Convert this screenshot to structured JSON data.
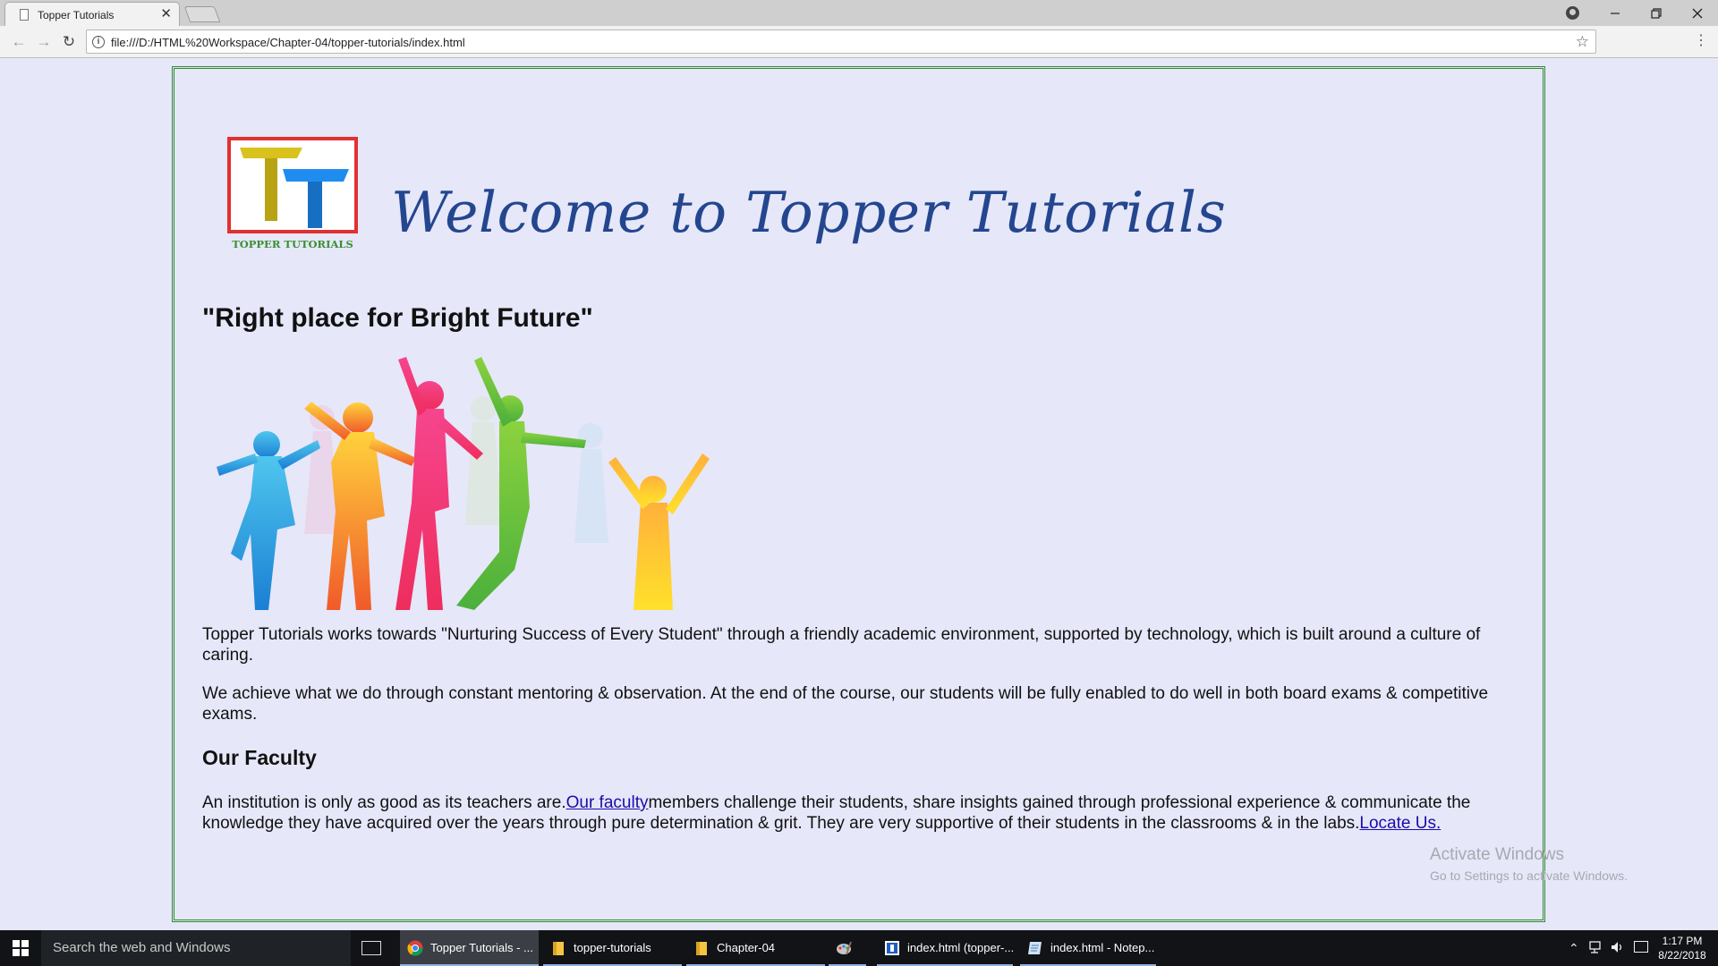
{
  "browser": {
    "tab_title": "Topper Tutorials",
    "url": "file:///D:/HTML%20Workspace/Chapter-04/topper-tutorials/index.html"
  },
  "page": {
    "logo_text": "TOPPER TUTORIALS",
    "welcome_heading": "Welcome to Topper Tutorials",
    "tagline": "\"Right place for Bright Future\"",
    "paragraph1": "Topper Tutorials works towards \"Nurturing Success of Every Student\" through a friendly academic environment, supported by technology, which is built around a culture of caring.",
    "paragraph2": "We achieve what we do through constant mentoring & observation. At the end of the course, our students will be fully enabled to do well in both board exams & competitive exams.",
    "faculty_heading": "Our Faculty",
    "faculty_para": {
      "before_link": "An institution is only as good as its teachers are.",
      "faculty_link": "Our faculty",
      "middle": "members challenge their students, share insights gained through professional experience & communicate the knowledge they have acquired over the years through pure determination & grit. They are very supportive of their students in the classrooms & in the labs.",
      "locate_link": "Locate Us."
    },
    "colors": {
      "background": "#e6e7f9",
      "heading_blue": "#24468f",
      "border_green": "#2f8a2f",
      "link": "#1a0dab"
    }
  },
  "watermark": {
    "line1": "Activate Windows",
    "line2": "Go to Settings to activate Windows."
  },
  "taskbar": {
    "search_placeholder": "Search the web and Windows",
    "items": [
      {
        "label": "Topper Tutorials - ...",
        "icon": "chrome-icon"
      },
      {
        "label": "topper-tutorials",
        "icon": "folder-icon"
      },
      {
        "label": "Chapter-04",
        "icon": "folder-icon"
      },
      {
        "label": "",
        "icon": "paint-icon"
      },
      {
        "label": "index.html (topper-...",
        "icon": "editor-icon"
      },
      {
        "label": "index.html - Notep...",
        "icon": "notepad-icon"
      }
    ],
    "time": "1:17 PM",
    "date": "8/22/2018"
  }
}
